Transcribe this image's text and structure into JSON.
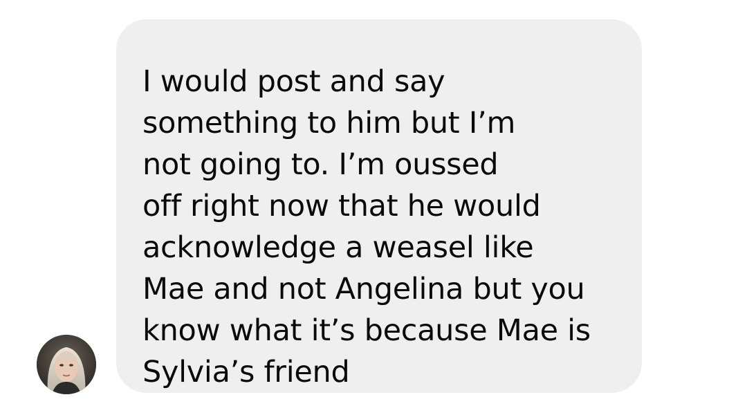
{
  "conversation": {
    "message": {
      "lines": [
        "I would post and say",
        "something to him but I’m",
        "not going to. I’m oussed",
        "off right now that he would",
        "acknowledge a weasel like",
        "Mae and not Angelina but you",
        "know what it’s because Mae is",
        "Sylvia’s friend"
      ]
    },
    "bubble_color": "#efefef",
    "text_color": "#0a0a0a"
  }
}
